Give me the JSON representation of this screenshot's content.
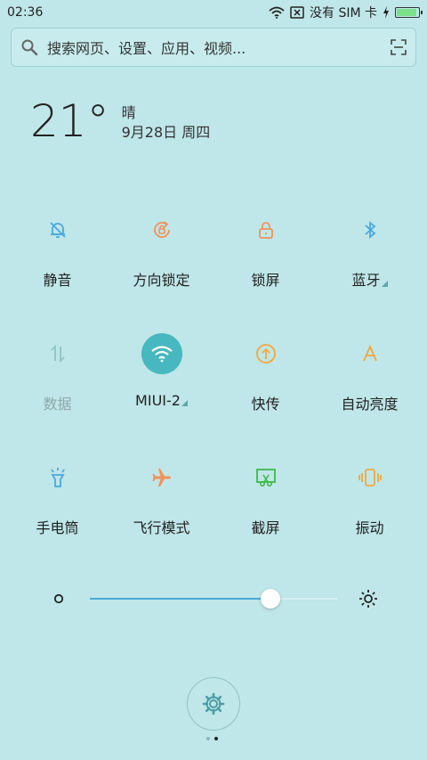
{
  "status_bar": {
    "time": "02:36",
    "sim_text": "没有 SIM 卡",
    "icons": [
      "wifi-icon",
      "sim-error-icon",
      "charging-icon",
      "battery-icon"
    ]
  },
  "search": {
    "placeholder": "搜索网页、设置、应用、视频...",
    "icons": [
      "search-icon",
      "scan-icon"
    ]
  },
  "weather": {
    "temperature": "21°",
    "condition": "晴",
    "date": "9月28日 周四"
  },
  "tiles": [
    [
      {
        "label": "静音",
        "icon": "bell-off-icon",
        "color": "#4aa9e0"
      },
      {
        "label": "方向锁定",
        "icon": "rotation-lock-icon",
        "color": "#f0935a"
      },
      {
        "label": "锁屏",
        "icon": "lock-icon",
        "color": "#f0935a"
      },
      {
        "label": "蓝牙",
        "icon": "bluetooth-icon",
        "color": "#4aa9e0",
        "has_more": true
      }
    ],
    [
      {
        "label": "数据",
        "icon": "data-icon",
        "color": "#8ec5c8",
        "disabled": true
      },
      {
        "label": "MIUI-2",
        "icon": "wifi-icon",
        "color": "#ffffff",
        "active": true,
        "has_more": true
      },
      {
        "label": "快传",
        "icon": "transfer-icon",
        "color": "#f3a83b"
      },
      {
        "label": "自动亮度",
        "icon": "auto-brightness-icon",
        "color": "#f3a83b"
      }
    ],
    [
      {
        "label": "手电筒",
        "icon": "flashlight-icon",
        "color": "#4aa9e0"
      },
      {
        "label": "飞行模式",
        "icon": "airplane-icon",
        "color": "#f0935a"
      },
      {
        "label": "截屏",
        "icon": "screenshot-icon",
        "color": "#3dbb4a"
      },
      {
        "label": "振动",
        "icon": "vibrate-icon",
        "color": "#f3a83b"
      }
    ]
  ],
  "brightness": {
    "level": 0.73,
    "icons": [
      "brightness-low-icon",
      "brightness-high-icon"
    ]
  },
  "page_indicator": {
    "count": 2,
    "current": 1
  },
  "colors": {
    "background": "#bfe6e8",
    "accent": "#47b8c0",
    "slider": "#4aa9d9"
  }
}
